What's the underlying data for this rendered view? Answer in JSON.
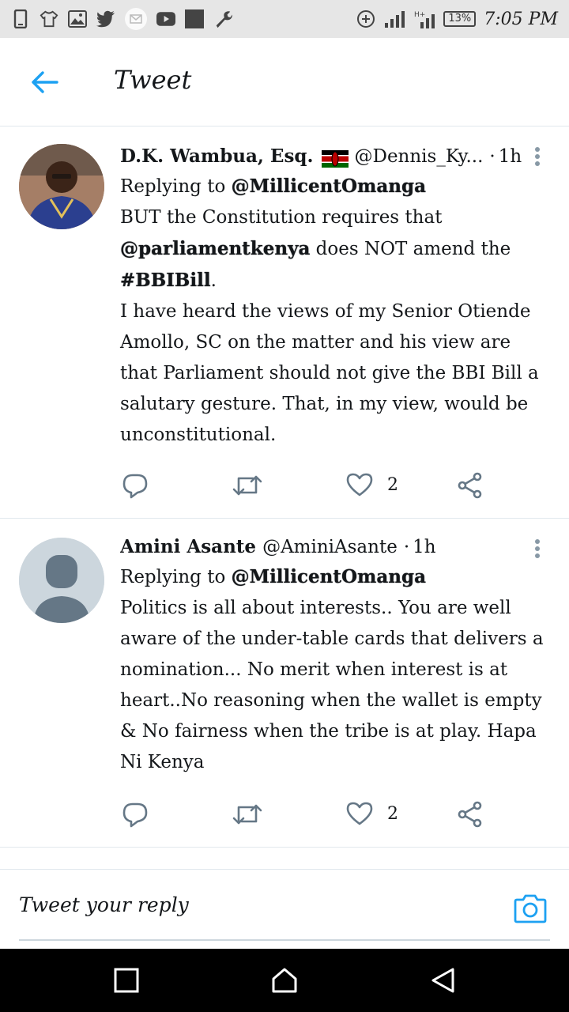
{
  "status_bar": {
    "time": "7:05 PM",
    "battery": "13%",
    "left_icons": [
      "phone-icon",
      "tshirt-icon",
      "image-icon",
      "twitter-icon",
      "mail-icon",
      "youtube-icon",
      "square-icon",
      "wrench-icon"
    ],
    "right_icons": [
      "data-saver-icon",
      "signal-icon",
      "signal-h-icon",
      "battery-icon"
    ]
  },
  "header": {
    "title": "Tweet"
  },
  "tweets": [
    {
      "name": "D.K. Wambua, Esq.",
      "handle": "@Dennis_Ky...",
      "dot": "·",
      "time": "1h",
      "replying_prefix": "Replying to",
      "replying_to": "@MillicentOmanga",
      "text_parts": {
        "p1": "BUT the Constitution requires that",
        "mention": "@parliamentkenya",
        "p2": "does NOT amend the",
        "hashtag": "#BBIBill",
        "p3": ".",
        "p4": "I have heard the views of my Senior Otiende Amollo, SC on the matter and his view are that Parliament should not give the BBI Bill a salutary gesture. That, in my view, would be unconstitutional."
      },
      "likes": "2"
    },
    {
      "name": "Amini Asante",
      "handle": "@AminiAsante",
      "dot": "·",
      "time": "1h",
      "replying_prefix": "Replying to",
      "replying_to": "@MillicentOmanga",
      "text": "Politics is all about interests.. You are well aware of the under-table cards that delivers a nomination... No merit when interest is at heart..No reasoning when the wallet is empty & No fairness when the tribe is at play. Hapa Ni Kenya",
      "likes": "2"
    }
  ],
  "reply_bar": {
    "placeholder": "Tweet your reply"
  },
  "colors": {
    "accent": "#1da1f2",
    "icon_gray": "#657786",
    "divider": "#e1e8ed"
  }
}
